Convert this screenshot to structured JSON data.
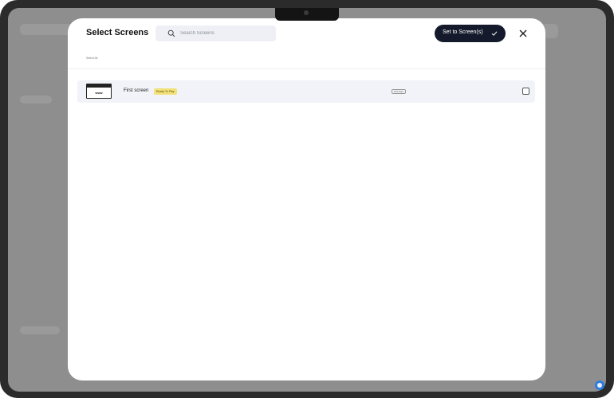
{
  "modal": {
    "title": "Select Screens",
    "search": {
      "placeholder": "Search Screens",
      "value": ""
    },
    "set_button_label": "Set to Screen(s)",
    "select_all_label": "Select All"
  },
  "screens": [
    {
      "thumb_label": "www",
      "name": "First screen",
      "status": "Ready To Play",
      "tag": "Web Page"
    }
  ],
  "colors": {
    "accent": "#141a2b",
    "badge": "#f2e27a",
    "row_bg": "#f1f3f8"
  },
  "icons": {
    "search": "search-icon",
    "confirm": "check-icon",
    "close": "close-icon"
  }
}
